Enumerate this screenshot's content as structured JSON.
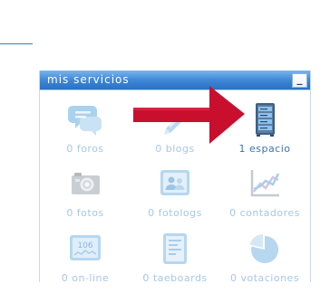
{
  "panel": {
    "title": "mis servicios",
    "minimize_label": "_"
  },
  "services": [
    {
      "label": "0 foros",
      "icon": "speech-bubbles-icon",
      "active": false
    },
    {
      "label": "0 blogs",
      "icon": "pencil-icon",
      "active": false
    },
    {
      "label": "1 espacio",
      "icon": "server-icon",
      "active": true
    },
    {
      "label": "0 fotos",
      "icon": "camera-icon",
      "active": false
    },
    {
      "label": "0 fotologs",
      "icon": "photo-people-icon",
      "active": false
    },
    {
      "label": "0 contadores",
      "icon": "chart-icon",
      "active": false
    },
    {
      "label": "0 on-line",
      "icon": "counter-display-icon",
      "active": false,
      "display_value": "106"
    },
    {
      "label": "0 taeboards",
      "icon": "board-icon",
      "active": false
    },
    {
      "label": "0 votaciones",
      "icon": "pie-chart-icon",
      "active": false
    }
  ],
  "colors": {
    "header_top": "#7ab6ec",
    "header_bottom": "#2a70c2",
    "label_inactive": "#a6c7e6",
    "label_active": "#3a73b9",
    "arrow": "#c8102e"
  }
}
